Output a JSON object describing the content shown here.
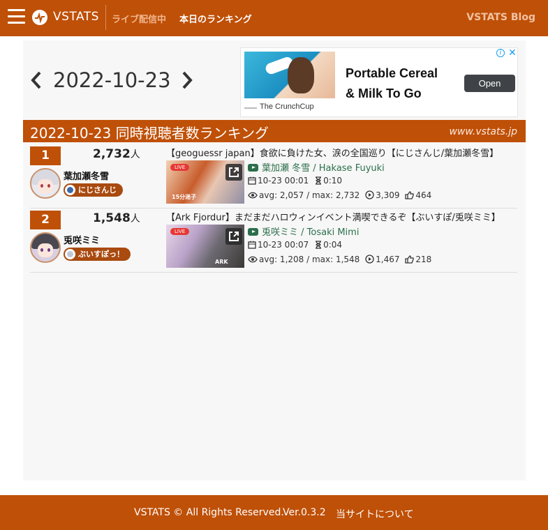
{
  "header": {
    "brand": "VSTATS",
    "nav_live": "ライブ配信中",
    "nav_ranking": "本日のランキング",
    "nav_blog": "VSTATS Blog",
    "brand_color": "#bf5007"
  },
  "date_nav": {
    "date": "2022-10-23"
  },
  "ad": {
    "headline_line1": "Portable Cereal",
    "headline_line2": "& Milk To Go",
    "cta": "Open",
    "source": "The CrunchCup",
    "info_icon": "info-icon",
    "close_icon": "close-icon"
  },
  "ranking": {
    "title": "2022-10-23 同時視聴者数ランキング",
    "site": "www.vstats.jp",
    "viewer_unit": "人",
    "rows": [
      {
        "rank": "1",
        "viewers": "2,732",
        "name": "葉加瀬冬雪",
        "group": "にじさんじ",
        "video_title": "【geoguessr japan】食欲に負けた女、涙の全国巡り【にじさんじ/葉加瀬冬雪】",
        "thumb_text": "15分迷子",
        "live_label": "LIVE",
        "channel": "葉加瀬 冬雪 / Hakase Fuyuki",
        "start": "10-23 00:01",
        "duration": "0:10",
        "stats": "avg: 2,057 / max: 2,732",
        "views": "3,309",
        "likes": "464"
      },
      {
        "rank": "2",
        "viewers": "1,548",
        "name": "兎咲ミミ",
        "group": "ぶいすぽっ！",
        "video_title": "【Ark Fjordur】まだまだハロウィンイベント満喫できるぞ【ぶいすぽ/兎咲ミミ】",
        "thumb_text": "ARK",
        "live_label": "LIVE",
        "channel": "兎咲ミミ / Tosaki Mimi",
        "start": "10-23 00:07",
        "duration": "0:04",
        "stats": "avg: 1,208 / max: 1,548",
        "views": "1,467",
        "likes": "218"
      }
    ]
  },
  "footer": {
    "copyright": "VSTATS © All Rights Reserved.",
    "version": "Ver.0.3.2",
    "about": "当サイトについて"
  }
}
